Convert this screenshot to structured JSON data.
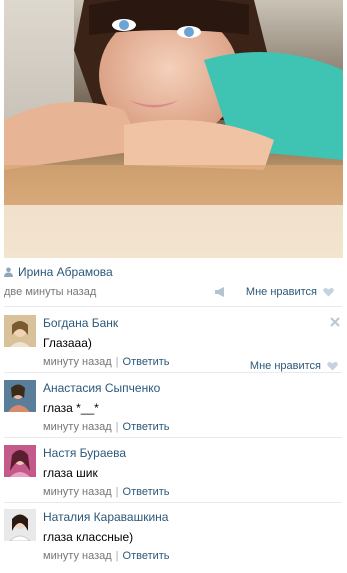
{
  "photo": {
    "alt": "profile photo"
  },
  "owner": {
    "name": "Ирина Абрамова",
    "time": "две минуты назад",
    "like_label": "Мне нравится"
  },
  "comments": [
    {
      "name": "Богдана Банк",
      "text": "Глазааа)",
      "time": "минуту назад",
      "reply": "Ответить",
      "like_label": "Мне нравится"
    },
    {
      "name": "Анастасия Сыпченко",
      "text": "глаза *__*",
      "time": "минуту назад",
      "reply": "Ответить"
    },
    {
      "name": "Настя Бураева",
      "text": "глаза шик",
      "time": "минуту назад",
      "reply": "Ответить"
    },
    {
      "name": "Наталия Каравашкина",
      "text": "глаза классные)",
      "time": "минуту назад",
      "reply": "Ответить"
    }
  ],
  "separator": "|",
  "colors": {
    "link": "#2b587a",
    "muted": "#777777",
    "divider": "#e6e9ee"
  }
}
